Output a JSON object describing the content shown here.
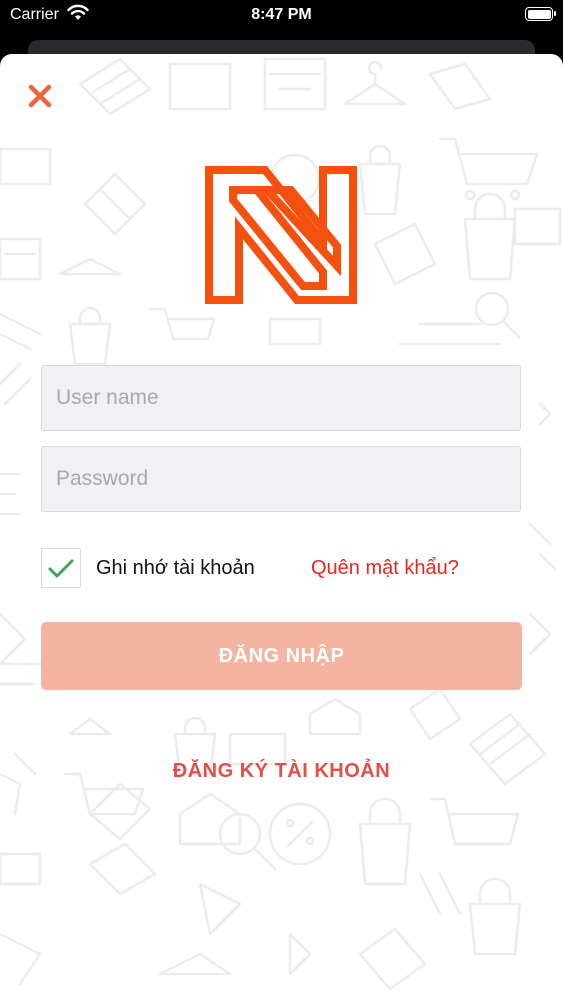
{
  "status_bar": {
    "carrier": "Carrier",
    "time": "8:47 PM"
  },
  "icons": {
    "close": "close-icon",
    "logo": "n-logo",
    "check": "checkmark-icon"
  },
  "colors": {
    "brand_orange": "#f4500f",
    "close_icon": "#e8643a",
    "login_button_bg": "#f3b4a1",
    "forgot_link": "#e8261f",
    "register_link": "#e14f46"
  },
  "form": {
    "username_placeholder": "User name",
    "username_value": "",
    "password_placeholder": "Password",
    "password_value": "",
    "remember_checked": true,
    "remember_label": "Ghi nhớ tài khoản",
    "forgot_label": "Quên mật khẩu?",
    "login_label": "ĐĂNG NHẬP",
    "register_label": "ĐĂNG KÝ TÀI KHOẢN"
  }
}
